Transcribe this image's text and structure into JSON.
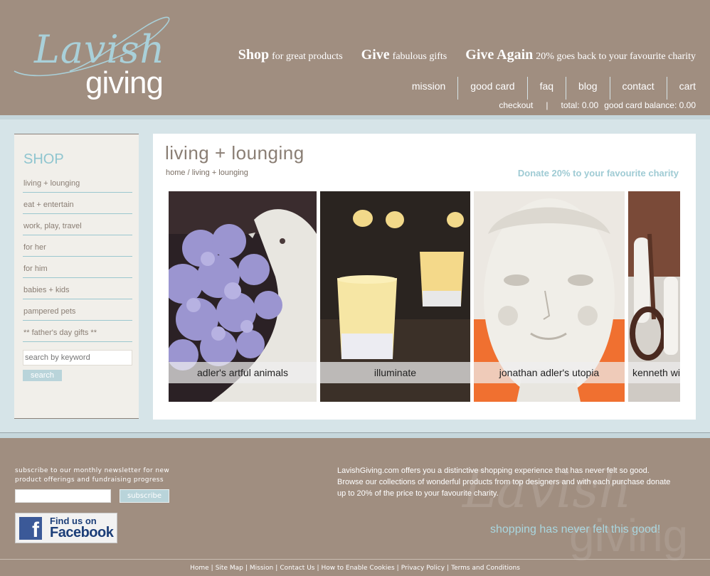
{
  "brand": {
    "script": "Lavish",
    "word": "giving"
  },
  "taglines": [
    {
      "bold": "Shop",
      "rest": "for great products"
    },
    {
      "bold": "Give",
      "rest": "fabulous gifts"
    },
    {
      "bold": "Give Again",
      "rest": "20% goes back to your favourite charity"
    }
  ],
  "nav": [
    "mission",
    "good card",
    "faq",
    "blog",
    "contact",
    "cart"
  ],
  "subnav": {
    "checkout": "checkout",
    "sep": "|",
    "total": "total: 0.00",
    "balance": "good card balance: 0.00"
  },
  "sidebar": {
    "title": "SHOP",
    "categories": [
      "living + lounging",
      "eat + entertain",
      "work, play, travel",
      "for her",
      "for him",
      "babies + kids",
      "pampered pets",
      "** father's day gifts **"
    ],
    "search_placeholder": "search by keyword",
    "search_button": "search"
  },
  "main": {
    "title": "living + lounging",
    "breadcrumb_home": "home",
    "breadcrumb_current": "/ living + lounging",
    "donate": "Donate 20% to your favourite charity",
    "products": [
      {
        "label": "adler's artful animals",
        "icon": "hydrangea-bird-image"
      },
      {
        "label": "illuminate",
        "icon": "candles-image"
      },
      {
        "label": "jonathan adler's utopia",
        "icon": "ceramic-face-image"
      },
      {
        "label": "kenneth wi",
        "icon": "vases-image"
      }
    ]
  },
  "footer": {
    "newsletter": "subscribe to our monthly newsletter for new product offerings and fundraising progress",
    "subscribe_button": "subscribe",
    "fb_find": "Find us on",
    "fb_name": "Facebook",
    "about": "LavishGiving.com offers you a distinctive shopping experience that has never felt so good. Browse our collections of wonderful products from top designers and with each purchase donate up to 20% of the price to your favourite charity.",
    "slogan": "shopping has never felt this good!",
    "links": [
      "Home",
      "Site Map",
      "Mission",
      "Contact Us",
      "How to Enable Cookies",
      "Privacy Policy",
      "Terms and Conditions"
    ]
  },
  "colors": {
    "header_bg": "#a08e80",
    "accent_blue": "#9fcbd4",
    "band": "#d6e4e8"
  }
}
